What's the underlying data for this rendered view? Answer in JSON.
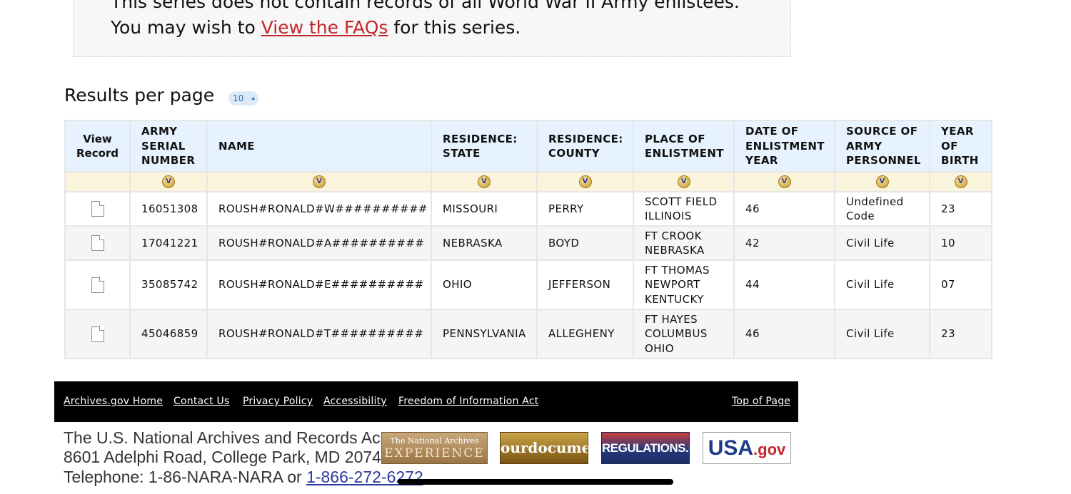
{
  "notice": {
    "line1": "This series does not contain records of all World War II Army enlistees.",
    "line2_prefix": "You may wish to ",
    "faq_link": "View the FAQs",
    "line2_suffix": " for this series."
  },
  "results_per_page": {
    "label": "Results per page",
    "value": "10"
  },
  "table": {
    "headers": [
      "View Record",
      "ARMY SERIAL NUMBER",
      "NAME",
      "RESIDENCE: STATE",
      "RESIDENCE: COUNTY",
      "PLACE OF ENLISTMENT",
      "DATE OF ENLISTMENT YEAR",
      "SOURCE OF ARMY PERSONNEL",
      "YEAR OF BIRTH"
    ],
    "rows": [
      {
        "serial": "16051308",
        "name": "ROUSH#RONALD#W##########",
        "state": "MISSOURI",
        "county": "PERRY",
        "place": [
          "SCOTT FIELD",
          "ILLINOIS"
        ],
        "year": "46",
        "source": [
          "Undefined",
          "Code"
        ],
        "birth": "23"
      },
      {
        "serial": "17041221",
        "name": "ROUSH#RONALD#A##########",
        "state": "NEBRASKA",
        "county": "BOYD",
        "place": [
          "FT CROOK",
          "NEBRASKA"
        ],
        "year": "42",
        "source": [
          "Civil Life"
        ],
        "birth": "10"
      },
      {
        "serial": "35085742",
        "name": "ROUSH#RONALD#E##########",
        "state": "OHIO",
        "county": "JEFFERSON",
        "place": [
          "FT THOMAS",
          "NEWPORT",
          "KENTUCKY"
        ],
        "year": "44",
        "source": [
          "Civil Life"
        ],
        "birth": "07"
      },
      {
        "serial": "45046859",
        "name": "ROUSH#RONALD#T##########",
        "state": "PENNSYLVANIA",
        "county": "ALLEGHENY",
        "place": [
          "FT HAYES",
          "COLUMBUS",
          "OHIO"
        ],
        "year": "46",
        "source": [
          "Civil Life"
        ],
        "birth": "23"
      }
    ]
  },
  "footer": {
    "links": [
      "Archives.gov Home",
      "Contact Us",
      "Privacy Policy",
      "Accessibility",
      "Freedom of Information Act"
    ],
    "top_link": "Top of Page",
    "address_line1": "The U.S. National Archives and Records Ac",
    "address_line2": "8601 Adelphi Road, College Park, MD 2074",
    "phone_prefix": "Telephone: 1-86-NARA-NARA or ",
    "phone_link": "1-866-272-6272",
    "badges": {
      "experience_small": "The National Archives",
      "experience_big": "EXPERIENCE",
      "ourdocuments": "ourdocuments",
      "regulations": "REGULATIONS.GOV",
      "usa": "USA",
      "usa_suffix": ".gov"
    }
  }
}
